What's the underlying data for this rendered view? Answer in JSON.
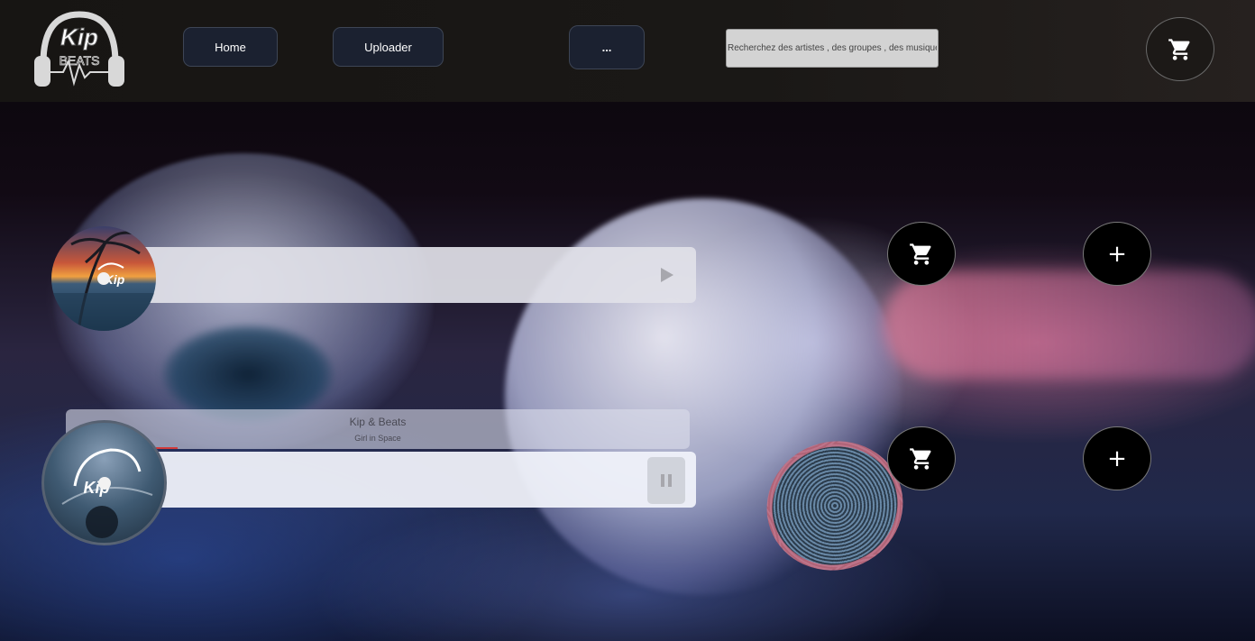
{
  "header": {
    "logo_text_top": "Kip",
    "logo_text_bottom": "BEATS",
    "nav": {
      "home_label": "Home",
      "uploader_label": "Uploader",
      "more_label": "..."
    },
    "search": {
      "placeholder": "Recherchez des artistes , des groupes , des musiques",
      "icon": "cart-icon"
    }
  },
  "tracks": [
    {
      "cover_icon": "album-cover",
      "cover_text": "Kip",
      "control": "play-icon"
    },
    {
      "cover_icon": "album-cover",
      "cover_text": "Kip",
      "control": "pause-icon",
      "artist": "Kip & Beats",
      "title": "Girl in Space",
      "progress": 0.035
    }
  ],
  "actions": {
    "cart_icon": "cart-icon",
    "add_label": "+"
  },
  "colors": {
    "header_bg": "#171513",
    "button_bg": "#1b2130",
    "progress": "#d23a3a",
    "action_bg": "#000000"
  }
}
